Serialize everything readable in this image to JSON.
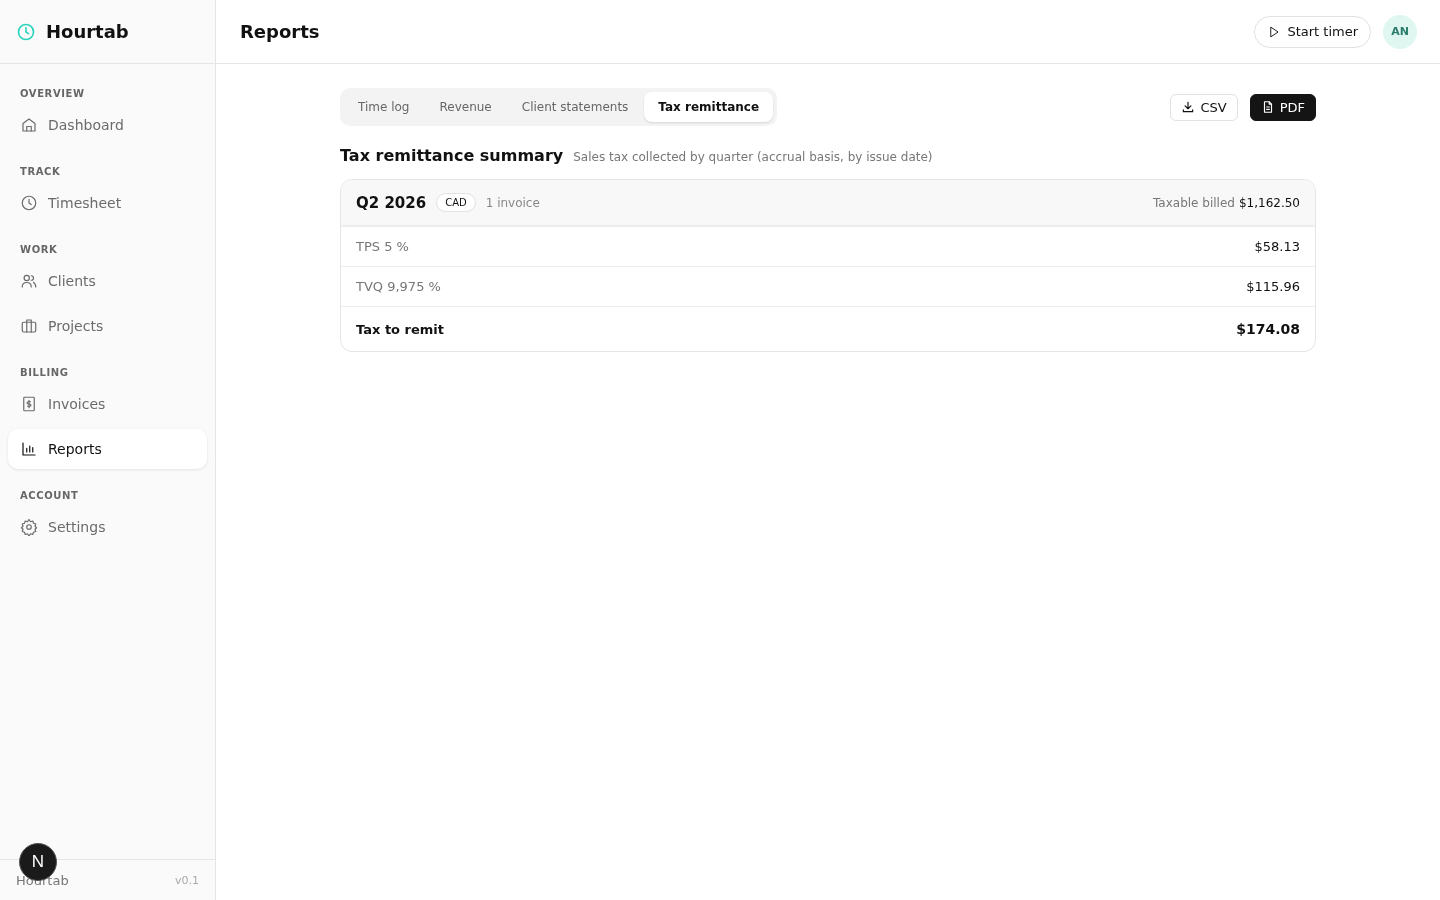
{
  "app": {
    "name": "Hourtab"
  },
  "sidebar": {
    "sections": [
      {
        "heading": "OVERVIEW",
        "items": [
          {
            "label": "Dashboard",
            "selected": false
          }
        ]
      },
      {
        "heading": "TRACK",
        "items": [
          {
            "label": "Timesheet",
            "selected": false
          }
        ]
      },
      {
        "heading": "WORK",
        "items": [
          {
            "label": "Clients",
            "selected": false
          },
          {
            "label": "Projects",
            "selected": false
          }
        ]
      },
      {
        "heading": "BILLING",
        "items": [
          {
            "label": "Invoices",
            "selected": false
          },
          {
            "label": "Reports",
            "selected": true
          }
        ]
      },
      {
        "heading": "ACCOUNT",
        "items": [
          {
            "label": "Settings",
            "selected": false
          }
        ]
      }
    ],
    "footer": {
      "name": "Hourtab",
      "version": "v0.1"
    },
    "badge": "N"
  },
  "header": {
    "title": "Reports",
    "timer_button": "Start timer",
    "avatar": "AN"
  },
  "tabs": [
    {
      "label": "Time log",
      "selected": false
    },
    {
      "label": "Revenue",
      "selected": false
    },
    {
      "label": "Client statements",
      "selected": false
    },
    {
      "label": "Tax remittance",
      "selected": true
    }
  ],
  "exports": [
    {
      "label": "CSV",
      "kind": "outline"
    },
    {
      "label": "PDF",
      "kind": "solid"
    }
  ],
  "summary": {
    "title": "Tax remittance summary",
    "subtitle": "Sales tax collected by quarter (accrual basis, by issue date)"
  },
  "quarter": {
    "period": "Q2 2026",
    "currency": "CAD",
    "invoices": "1 invoice",
    "taxable_label": "Taxable billed",
    "taxable_value": "$1,162.50",
    "rows": [
      {
        "kind": "line",
        "label": "TPS 5 %",
        "value": "$58.13"
      },
      {
        "kind": "line",
        "label": "TVQ 9,975 %",
        "value": "$115.96"
      },
      {
        "kind": "total",
        "label": "Tax to remit",
        "value": "$174.08"
      }
    ]
  }
}
